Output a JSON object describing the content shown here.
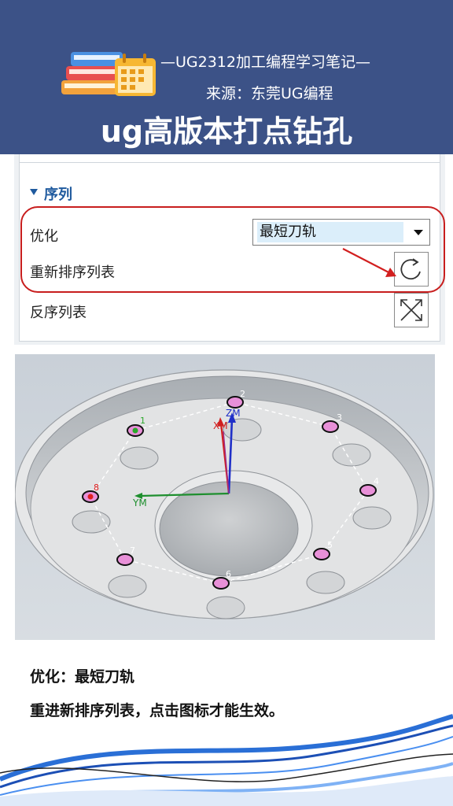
{
  "header": {
    "subtitle": "—UG2312加工编程学习笔记—",
    "source": "来源：东莞UG编程",
    "title": "ug高版本打点钻孔"
  },
  "panel": {
    "section_title": "序列",
    "optimize_label": "优化",
    "optimize_value": "最短刀轨",
    "reorder_label": "重新排序列表",
    "reverse_label": "反序列表"
  },
  "viewport": {
    "axis_zm": "ZM",
    "axis_xm": "XM",
    "axis_ym": "YM",
    "points": [
      "1",
      "2",
      "3",
      "4",
      "5",
      "6",
      "7",
      "8"
    ]
  },
  "notes": {
    "line1": "优化：最短刀轨",
    "line2": "重进新排序列表，点击图标才能生效。"
  },
  "colors": {
    "header_bg": "#3c5287",
    "section_blue": "#1f5a9e",
    "highlight_red": "#c81e1e",
    "point_pink": "#e890d8"
  }
}
